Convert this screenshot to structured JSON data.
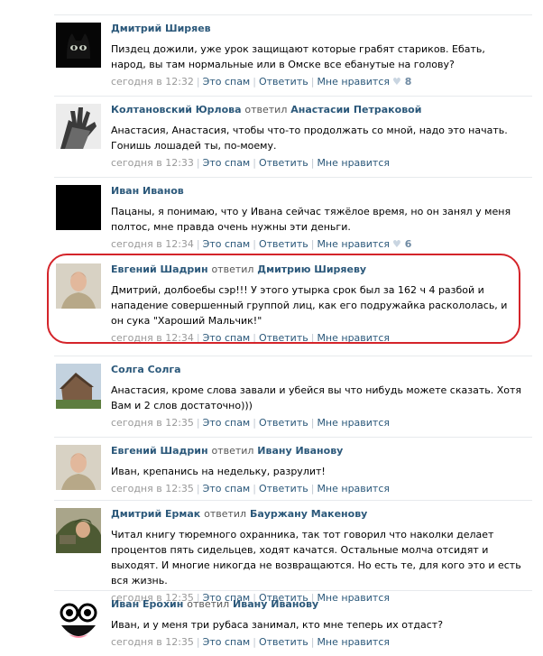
{
  "comments": [
    {
      "author": "Дмитрий Ширяев",
      "replied": "",
      "reply_to": "",
      "text": "Пиздец дожили, уже урок защищают которые грабят стариков. Ебать, народ, вы там нормальные или в Омске все ебанутые на голову?",
      "time": "сегодня в 12:32",
      "spam": "Это спам",
      "reply": "Ответить",
      "like": "Мне нравится",
      "likes": "8"
    },
    {
      "author": "Колтановский Юрлова",
      "replied": "ответил",
      "reply_to": "Анастасии Петраковой",
      "text": "Анастасия, Анастасия, чтобы что-то продолжать со мной, надо это начать. Гонишь лошадей ты, по-моему.",
      "time": "сегодня в 12:33",
      "spam": "Это спам",
      "reply": "Ответить",
      "like": "Мне нравится",
      "likes": ""
    },
    {
      "author": "Иван Иванов",
      "replied": "",
      "reply_to": "",
      "text": "Пацаны, я понимаю, что у Ивана сейчас тяжёлое время, но он занял у меня полтос, мне правда очень нужны эти деньги.",
      "time": "сегодня в 12:34",
      "spam": "Это спам",
      "reply": "Ответить",
      "like": "Мне нравится",
      "likes": "6"
    },
    {
      "author": "Евгений Шадрин",
      "replied": "ответил",
      "reply_to": "Дмитрию Ширяеву",
      "text": "Дмитрий, долбоебы сэр!!! У этого утырка срок был за 162 ч 4 разбой и нападение совершенный группой лиц, как его подружайка раскололась, и он сука \"Хароший Мальчик!\"",
      "time": "сегодня в 12:34",
      "spam": "Это спам",
      "reply": "Ответить",
      "like": "Мне нравится",
      "likes": ""
    },
    {
      "author": "Солга Солга",
      "replied": "",
      "reply_to": "",
      "text": "Анастасия, кроме слова завали и убейся вы что нибудь можете сказать. Хотя Вам и 2 слов достаточно)))",
      "time": "сегодня в 12:35",
      "spam": "Это спам",
      "reply": "Ответить",
      "like": "Мне нравится",
      "likes": ""
    },
    {
      "author": "Евгений Шадрин",
      "replied": "ответил",
      "reply_to": "Ивану Иванову",
      "text": "Иван, крепанись на недельку, разрулит!",
      "time": "сегодня в 12:35",
      "spam": "Это спам",
      "reply": "Ответить",
      "like": "Мне нравится",
      "likes": ""
    },
    {
      "author": "Дмитрий Ермак",
      "replied": "ответил",
      "reply_to": "Бауржану Макенову",
      "text": "Читал книгу тюремного охранника, так тот говорил что наколки делает процентов пять сидельцев, ходят качатся. Остальные молча отсидят и выходят. И многие никогда не возвращаются. Но есть те, для кого это и есть вся жизнь.",
      "time": "сегодня в 12:35",
      "spam": "Это спам",
      "reply": "Ответить",
      "like": "Мне нравится",
      "likes": ""
    },
    {
      "author": "Иван Ерохин",
      "replied": "ответил",
      "reply_to": "Ивану Иванову",
      "text": "Иван, и у меня три рубаса занимал, кто мне теперь их отдаст?",
      "time": "сегодня в 12:35",
      "spam": "Это спам",
      "reply": "Ответить",
      "like": "Мне нравится",
      "likes": ""
    }
  ]
}
